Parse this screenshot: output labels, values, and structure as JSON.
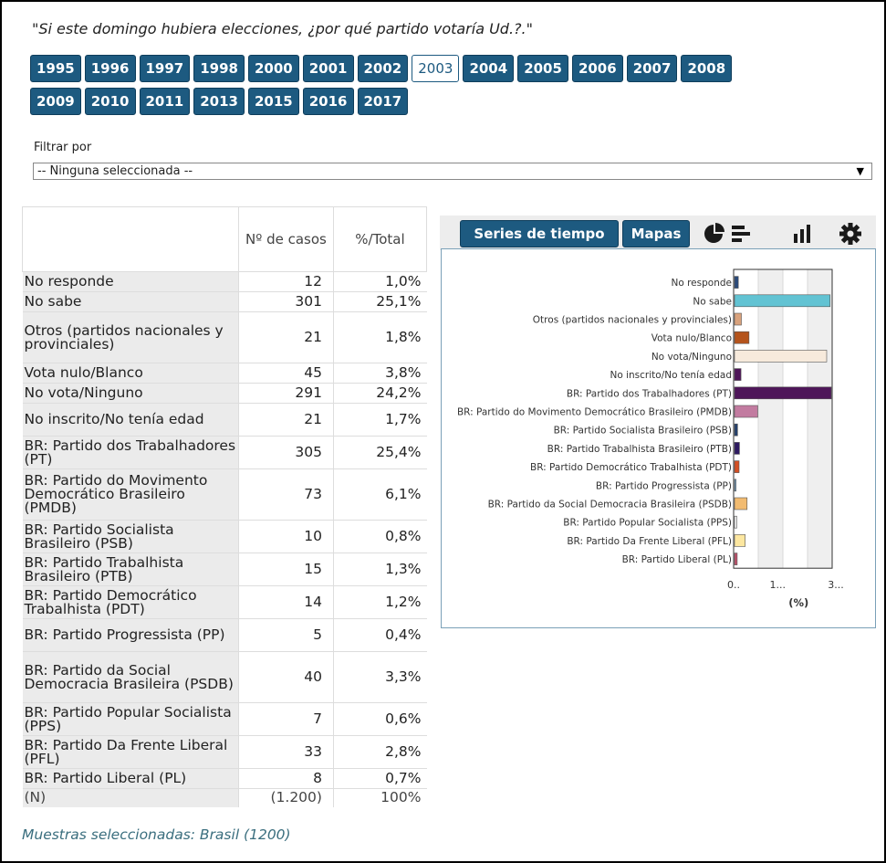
{
  "question": "\"Si este domingo hubiera elecciones, ¿por qué partido votaría Ud.?.\"",
  "years": {
    "row1": [
      "1995",
      "1996",
      "1997",
      "1998",
      "2000",
      "2001",
      "2002",
      "2003",
      "2004",
      "2005",
      "2006",
      "2007",
      "2008"
    ],
    "row2": [
      "2009",
      "2010",
      "2011",
      "2013",
      "2015",
      "2016",
      "2017"
    ],
    "selected": "2003"
  },
  "filter": {
    "label": "Filtrar por",
    "value": "-- Ninguna seleccionada --"
  },
  "table": {
    "headers": {
      "count": "Nº de casos",
      "pct": "%/Total"
    },
    "rows": [
      {
        "label": "No responde",
        "count": "12",
        "pct": "1,0%"
      },
      {
        "label": "No sabe",
        "count": "301",
        "pct": "25,1%"
      },
      {
        "label": "Otros (partidos nacionales y provinciales)",
        "count": "21",
        "pct": "1,8%"
      },
      {
        "label": "Vota nulo/Blanco",
        "count": "45",
        "pct": "3,8%"
      },
      {
        "label": "No vota/Ninguno",
        "count": "291",
        "pct": "24,2%"
      },
      {
        "label": "No inscrito/No tenía edad",
        "count": "21",
        "pct": "1,7%"
      },
      {
        "label": "BR: Partido dos Trabalhadores (PT)",
        "count": "305",
        "pct": "25,4%"
      },
      {
        "label": "BR: Partido do Movimento Democrático Brasileiro (PMDB)",
        "count": "73",
        "pct": "6,1%"
      },
      {
        "label": "BR: Partido Socialista Brasileiro (PSB)",
        "count": "10",
        "pct": "0,8%"
      },
      {
        "label": "BR: Partido Trabalhista Brasileiro (PTB)",
        "count": "15",
        "pct": "1,3%"
      },
      {
        "label": "BR: Partido Democrático Trabalhista (PDT)",
        "count": "14",
        "pct": "1,2%"
      },
      {
        "label": "BR: Partido Progressista (PP)",
        "count": "5",
        "pct": "0,4%"
      },
      {
        "label": "BR: Partido da Social Democracia Brasileira (PSDB)",
        "count": "40",
        "pct": "3,3%"
      },
      {
        "label": "BR: Partido Popular Socialista (PPS)",
        "count": "7",
        "pct": "0,6%"
      },
      {
        "label": "BR: Partido Da Frente Liberal (PFL)",
        "count": "33",
        "pct": "2,8%"
      },
      {
        "label": "BR: Partido Liberal (PL)",
        "count": "8",
        "pct": "0,7%"
      }
    ],
    "total": {
      "label": "(N)",
      "count": "(1.200)",
      "pct": "100%"
    }
  },
  "samples": "Muestras seleccionadas: Brasil (1200)",
  "toolbar": {
    "series_label": "Series de tiempo",
    "maps_label": "Mapas",
    "icons": [
      "pie-chart-icon",
      "horizontal-bar-icon",
      "vertical-bar-icon",
      "gear-icon"
    ]
  },
  "chart_data": {
    "type": "bar",
    "orientation": "horizontal",
    "categories": [
      "No responde",
      "No sabe",
      "Otros (partidos nacionales y provinciales)",
      "Vota nulo/Blanco",
      "No vota/Ninguno",
      "No inscrito/No tenía edad",
      "BR: Partido dos Trabalhadores (PT)",
      "BR: Partido do Movimento Democrático Brasileiro (PMDB)",
      "BR: Partido Socialista Brasileiro (PSB)",
      "BR: Partido Trabalhista Brasileiro (PTB)",
      "BR: Partido Democrático Trabalhista (PDT)",
      "BR: Partido Progressista (PP)",
      "BR: Partido da Social Democracia Brasileira (PSDB)",
      "BR: Partido Popular Socialista (PPS)",
      "BR: Partido Da Frente Liberal (PFL)",
      "BR: Partido Liberal (PL)"
    ],
    "values": [
      1.0,
      25.1,
      1.8,
      3.8,
      24.2,
      1.7,
      25.4,
      6.1,
      0.8,
      1.3,
      1.2,
      0.4,
      3.3,
      0.6,
      2.8,
      0.7
    ],
    "colors": [
      "#2b4a7a",
      "#62c3d3",
      "#d9a27c",
      "#b5541c",
      "#f7eadc",
      "#4e1659",
      "#4e1659",
      "#c27ba0",
      "#243f6b",
      "#2d1960",
      "#d44f23",
      "#7aa2c4",
      "#f2bb70",
      "#f3f3f3",
      "#fde7a0",
      "#c0506a"
    ],
    "xlabel": "(%)",
    "xticks": [
      "0..",
      "1...",
      "3..."
    ],
    "xlim": [
      0,
      25.4
    ],
    "grid": true
  }
}
